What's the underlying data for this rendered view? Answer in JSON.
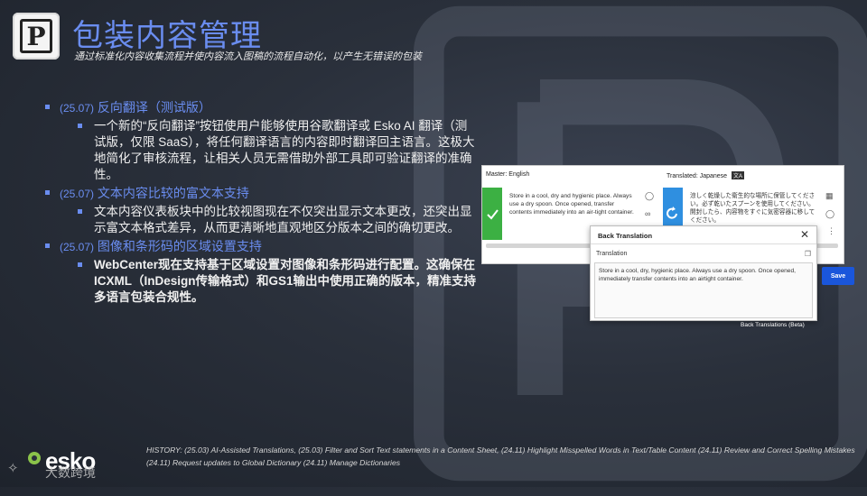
{
  "header": {
    "title": "包装内容管理",
    "subtitle": "通过标准化内容收集流程并使内容流入图稿的流程自动化，以产生无错误的包装"
  },
  "features": [
    {
      "version": "(25.07)",
      "title": "反向翻译（测试版）",
      "detail": "一个新的“反向翻译”按钮使用户能够使用谷歌翻译或 Esko AI 翻译（测试版，仅限 SaaS），将任何翻译语言的内容即时翻译回主语言。这极大地简化了审核流程，让相关人员无需借助外部工具即可验证翻译的准确性。"
    },
    {
      "version": "(25.07)",
      "title": "文本内容比较的富文本支持",
      "detail": "文本内容仪表板块中的比较视图现在不仅突出显示文本更改，还突出显示富文本格式差异，从而更清晰地直观地区分版本之间的确切更改。"
    },
    {
      "version": "(25.07)",
      "title": "图像和条形码的区域设置支持",
      "detail": "WebCenter现在支持基于区域设置对图像和条形码进行配置。这确保在ICXML（InDesign传输格式）和GS1输出中使用正确的版本，精准支持多语言包装合规性。"
    }
  ],
  "screenshot": {
    "master_label": "Master: English",
    "translated_label": "Translated: Japanese",
    "master_text": "Store in a cool, dry and hygienic place. Always use a dry spoon. Once opened, transfer contents immediately into an air-tight container.",
    "translated_text": "涼しく乾燥した衛生的な場所に保管してください。必ず乾いたスプーンを使用してください。開封したら、内容物をすぐに気密容器に移してください。",
    "dialog_title": "Back Translation",
    "dialog_label": "Translation",
    "dialog_text": "Store in a cool, dry, hygienic place. Always use a dry spoon. Once opened, immediately transfer contents into an airtight container.",
    "save_label": "Save",
    "caption": "Back Translations (Beta)"
  },
  "footer": {
    "logo_text": "esko",
    "watermark": "大数跨境",
    "history": "HISTORY: (25.03) AI-Assisted Translations, (25.03) Filter and Sort Text statements in a Content Sheet, (24.11) Highlight Misspelled Words in Text/Table Content (24.11)  Review and Correct Spelling Mistakes (24.11)  Request updates to Global Dictionary (24.11) Manage Dictionaries"
  },
  "colors": {
    "accent": "#6a8df0",
    "green": "#3cb043",
    "blue": "#2f8fe0",
    "save": "#1a56db"
  }
}
